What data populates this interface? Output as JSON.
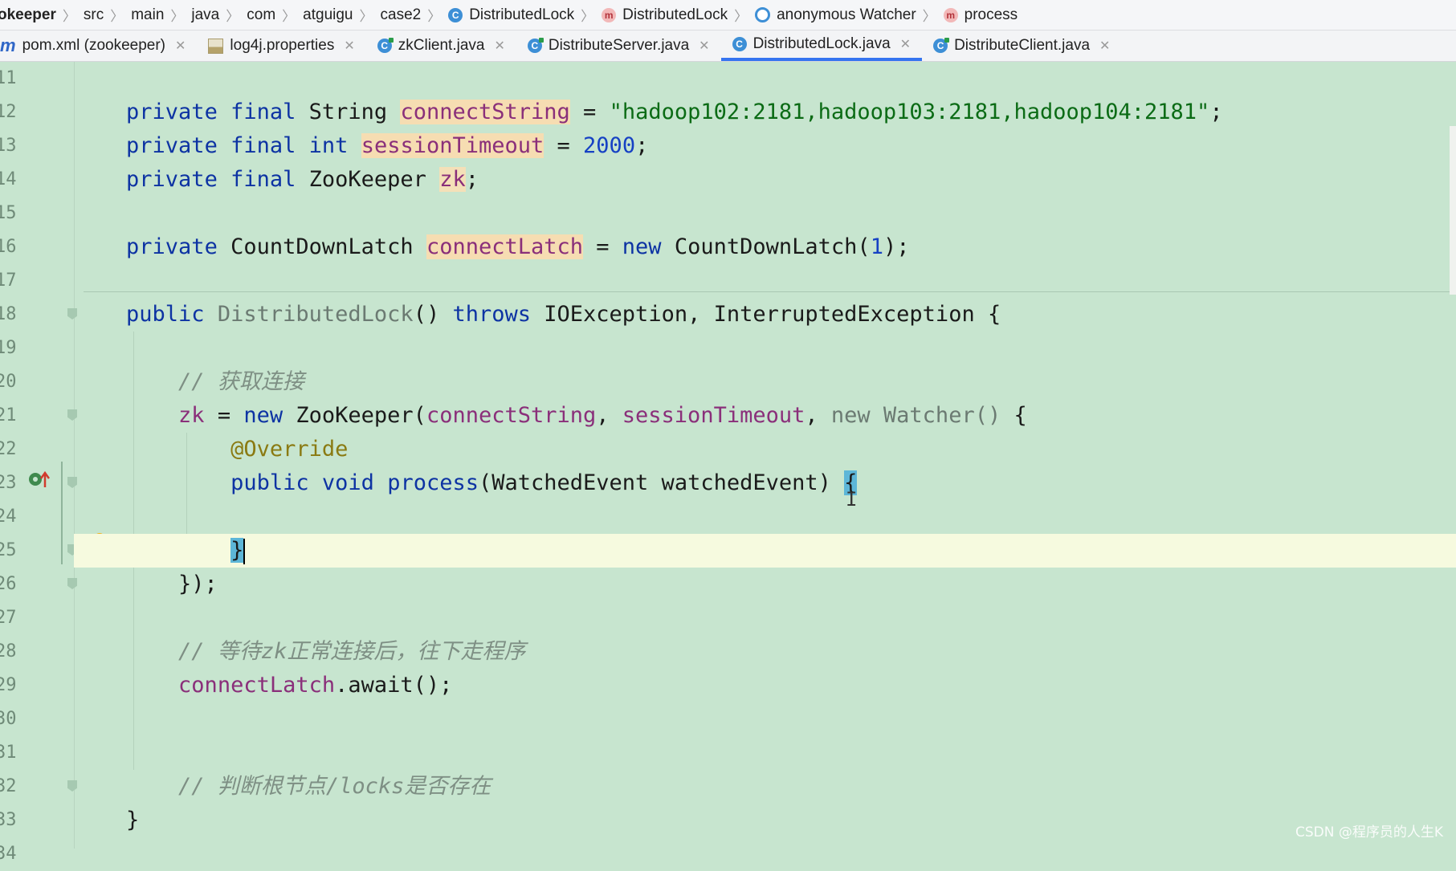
{
  "breadcrumb": [
    {
      "label": "okeeper",
      "icon": ""
    },
    {
      "label": "src",
      "icon": ""
    },
    {
      "label": "main",
      "icon": ""
    },
    {
      "label": "java",
      "icon": ""
    },
    {
      "label": "com",
      "icon": ""
    },
    {
      "label": "atguigu",
      "icon": ""
    },
    {
      "label": "case2",
      "icon": ""
    },
    {
      "label": "DistributedLock",
      "icon": "class-icon"
    },
    {
      "label": "DistributedLock",
      "icon": "method-icon"
    },
    {
      "label": "anonymous Watcher",
      "icon": "anonymous-class-icon"
    },
    {
      "label": "process",
      "icon": "method-icon"
    }
  ],
  "tabs": [
    {
      "label": "pom.xml (zookeeper)",
      "icon": "maven-icon",
      "active": false
    },
    {
      "label": "log4j.properties",
      "icon": "properties-file-icon",
      "active": false
    },
    {
      "label": "zkClient.java",
      "icon": "java-class-icon",
      "active": false
    },
    {
      "label": "DistributeServer.java",
      "icon": "java-class-icon",
      "active": false
    },
    {
      "label": "DistributedLock.java",
      "icon": "java-class-icon",
      "active": true
    },
    {
      "label": "DistributeClient.java",
      "icon": "java-class-icon",
      "active": false
    }
  ],
  "gutter": {
    "line_numbers": [
      "11",
      "12",
      "13",
      "14",
      "15",
      "16",
      "17",
      "18",
      "19",
      "20",
      "21",
      "22",
      "23",
      "24",
      "25",
      "26",
      "27",
      "28",
      "29",
      "30",
      "31",
      "32",
      "33",
      "34"
    ]
  },
  "code": {
    "l12": {
      "kw1": "private",
      "kw2": "final",
      "type": "String",
      "field": "connectString",
      "eq": " = ",
      "str": "\"hadoop102:2181,hadoop103:2181,hadoop104:2181\"",
      "end": ";"
    },
    "l13": {
      "kw1": "private",
      "kw2": "final",
      "kw3": "int",
      "field": "sessionTimeout",
      "eq": " = ",
      "num": "2000",
      "end": ";"
    },
    "l14": {
      "kw1": "private",
      "kw2": "final",
      "type": "ZooKeeper",
      "field": "zk",
      "end": ";"
    },
    "l16": {
      "kw1": "private",
      "type": "CountDownLatch",
      "field": "connectLatch",
      "eq": " = ",
      "kw2": "new",
      "call": "CountDownLatch(",
      "num": "1",
      "end": ");"
    },
    "l18": {
      "kw1": "public",
      "ctor": "DistributedLock",
      "paren": "() ",
      "kw2": "throws",
      "rest": " IOException, InterruptedException {"
    },
    "l20": {
      "comment": "// 获取连接"
    },
    "l21": {
      "var": "zk",
      "eq": " = ",
      "kw1": "new",
      "call": " ZooKeeper(",
      "f1": "connectString",
      "sep": ", ",
      "f2": "sessionTimeout",
      "sep2": ", ",
      "kw2": "new",
      "watcher": " Watcher() ",
      "brace": "{"
    },
    "l22": {
      "anno": "@Override"
    },
    "l23": {
      "kw1": "public",
      "kw2": "void",
      "method": "process",
      "params": "(WatchedEvent watchedEvent) ",
      "brace": "{"
    },
    "l25": {
      "brace": "}"
    },
    "l26": {
      "text": "});"
    },
    "l28": {
      "comment": "// 等待zk正常连接后，往下走程序"
    },
    "l29": {
      "field": "connectLatch",
      "call": ".await();"
    },
    "l32": {
      "comment": "// 判断根节点/locks是否存在"
    },
    "l33": {
      "brace": "}"
    }
  },
  "watermark": "CSDN @程序员的人生K",
  "colors": {
    "editor_bg": "#c7e5cf",
    "keyword": "#0d33a3",
    "string": "#0b6b15",
    "field": "#8a2f7a",
    "active_tab": "#3574f0"
  }
}
